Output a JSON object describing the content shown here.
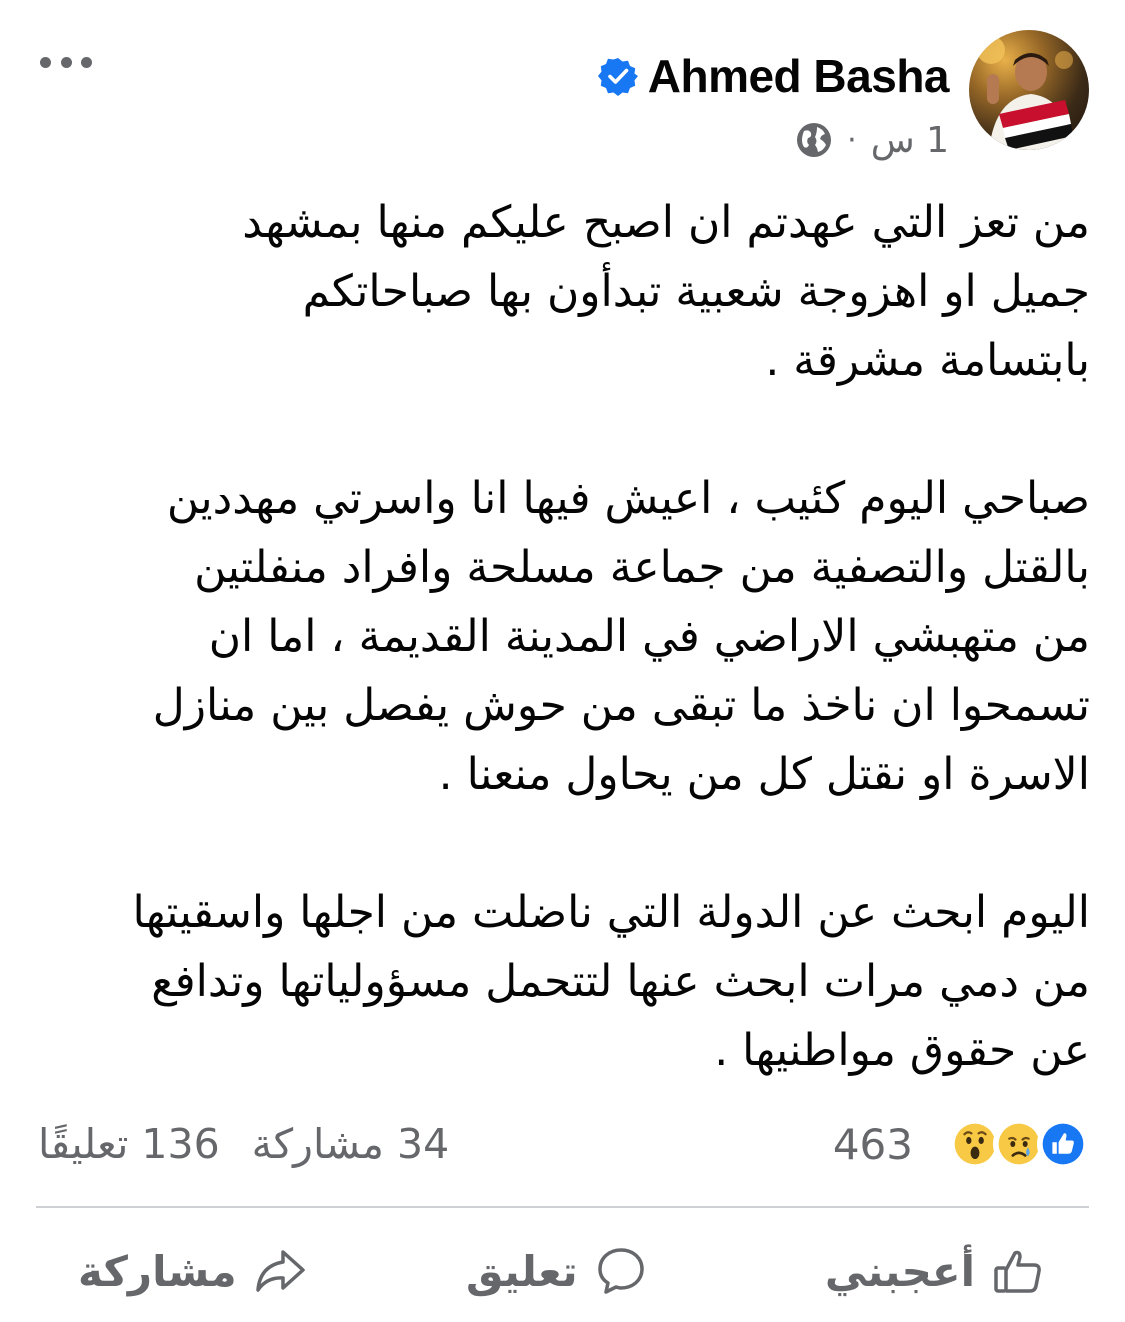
{
  "post": {
    "author": "Ahmed Basha",
    "time": "1 س",
    "paragraphs": [
      [
        "من تعز التي عهدتم ان اصبح عليكم منها بمشهد",
        "جميل او اهزوجة شعبية تبدأون بها صباحاتكم",
        "بابتسامة مشرقة ."
      ],
      [
        "صباحي اليوم كئيب ، اعيش فيها انا واسرتي مهددين",
        "بالقتل والتصفية من جماعة مسلحة وافراد منفلتين",
        "من متهبشي الاراضي في المدينة القديمة ، اما ان",
        "تسمحوا ان ناخذ ما تبقى من حوش يفصل بين منازل",
        "الاسرة او نقتل كل من يحاول منعنا ."
      ],
      [
        "اليوم ابحث عن الدولة التي ناضلت من اجلها واسقيتها",
        "من دمي مرات ابحث عنها لتتحمل مسؤولياتها وتدافع",
        "عن حقوق مواطنيها ."
      ]
    ]
  },
  "reactions": {
    "icons": [
      "like-icon",
      "sad-icon",
      "wow-icon"
    ],
    "count": "463"
  },
  "stats": {
    "shares": "34 مشاركة",
    "comments": "136 تعليقًا"
  },
  "actions": {
    "like": "أعجبني",
    "comment": "تعليق",
    "share": "مشاركة"
  },
  "colors": {
    "verified": "#1877f2",
    "muted": "#65676b",
    "like": "#1877f2",
    "emoji": "#f7c944",
    "divider": "#ced0d4"
  }
}
